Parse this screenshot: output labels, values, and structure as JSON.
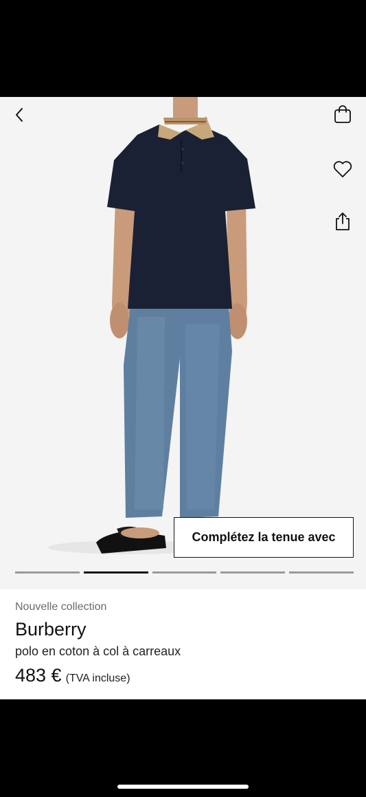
{
  "hero": {
    "complete_look_label": "Complétez la tenue avec",
    "pager": {
      "total": 5,
      "active_index": 1
    }
  },
  "product": {
    "tag": "Nouvelle collection",
    "brand": "Burberry",
    "description": "polo en coton à col à carreaux",
    "price": "483 €",
    "tax_note": "(TVA incluse)"
  },
  "colors": {
    "polo": "#1b2134",
    "jeans": "#5f7fa0",
    "background": "#f4f4f4"
  }
}
